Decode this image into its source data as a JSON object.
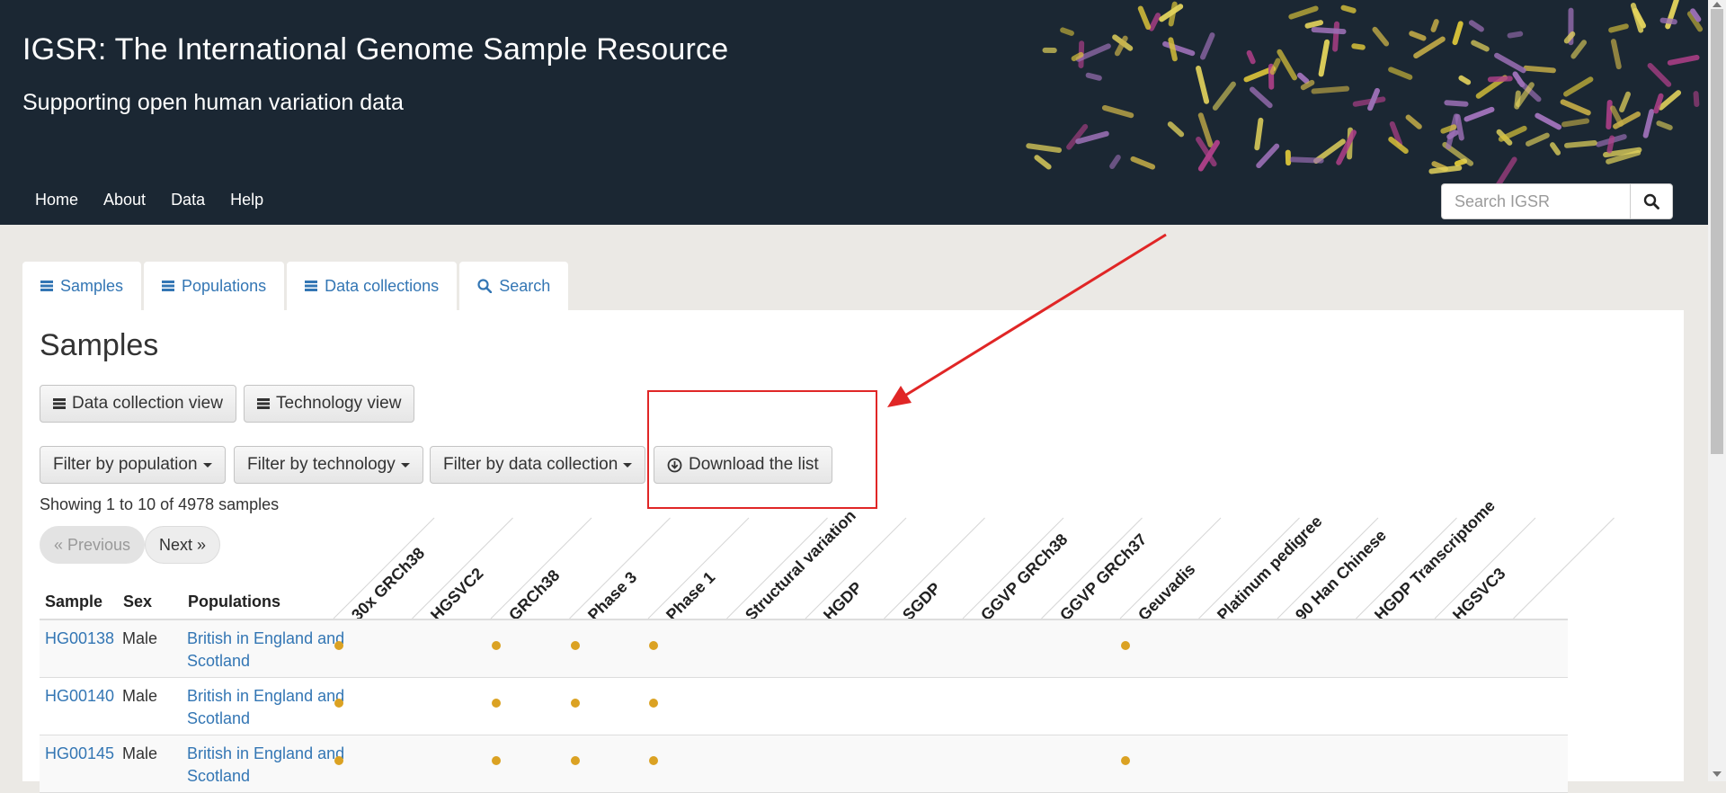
{
  "header": {
    "title": "IGSR: The International Genome Sample Resource",
    "subtitle": "Supporting open human variation data",
    "banner": "chromosome-art",
    "nav": [
      "Home",
      "About",
      "Data",
      "Help"
    ],
    "search_placeholder": "Search IGSR"
  },
  "tabs": [
    {
      "label": "Samples",
      "icon": "list-icon"
    },
    {
      "label": "Populations",
      "icon": "list-icon"
    },
    {
      "label": "Data collections",
      "icon": "list-icon"
    },
    {
      "label": "Search",
      "icon": "search-icon"
    }
  ],
  "main": {
    "title": "Samples",
    "view_buttons": [
      "Data collection view",
      "Technology view"
    ],
    "filters": [
      "Filter by population",
      "Filter by technology",
      "Filter by data collection"
    ],
    "download_label": "Download the list",
    "showing": "Showing 1 to 10 of 4978 samples",
    "pager": {
      "previous": "« Previous",
      "next": "Next »"
    }
  },
  "table": {
    "headers": [
      "Sample",
      "Sex",
      "Populations"
    ],
    "collections": [
      "30x GRCh38",
      "HGSVC2",
      "GRCh38",
      "Phase 3",
      "Phase 1",
      "Structural variation",
      "HGDP",
      "SGDP",
      "GGVP GRCh38",
      "GGVP GRCh37",
      "Geuvadis",
      "Platinum pedigree",
      "90 Han Chinese",
      "HGDP Transcriptome",
      "HGSVC3"
    ],
    "rows": [
      {
        "sample": "HG00138",
        "sex": "Male",
        "population": "British in England and Scotland",
        "in": [
          true,
          false,
          true,
          true,
          true,
          false,
          false,
          false,
          false,
          false,
          true,
          false,
          false,
          false,
          false
        ]
      },
      {
        "sample": "HG00140",
        "sex": "Male",
        "population": "British in England and Scotland",
        "in": [
          true,
          false,
          true,
          true,
          true,
          false,
          false,
          false,
          false,
          false,
          false,
          false,
          false,
          false,
          false
        ]
      },
      {
        "sample": "HG00145",
        "sex": "Male",
        "population": "British in England and Scotland",
        "in": [
          true,
          false,
          true,
          true,
          true,
          false,
          false,
          false,
          false,
          false,
          true,
          false,
          false,
          false,
          false
        ]
      }
    ]
  },
  "colors": {
    "header_bg": "#1b2733",
    "link": "#3376b4",
    "dot": "#dba223",
    "annotation": "#e02626"
  }
}
